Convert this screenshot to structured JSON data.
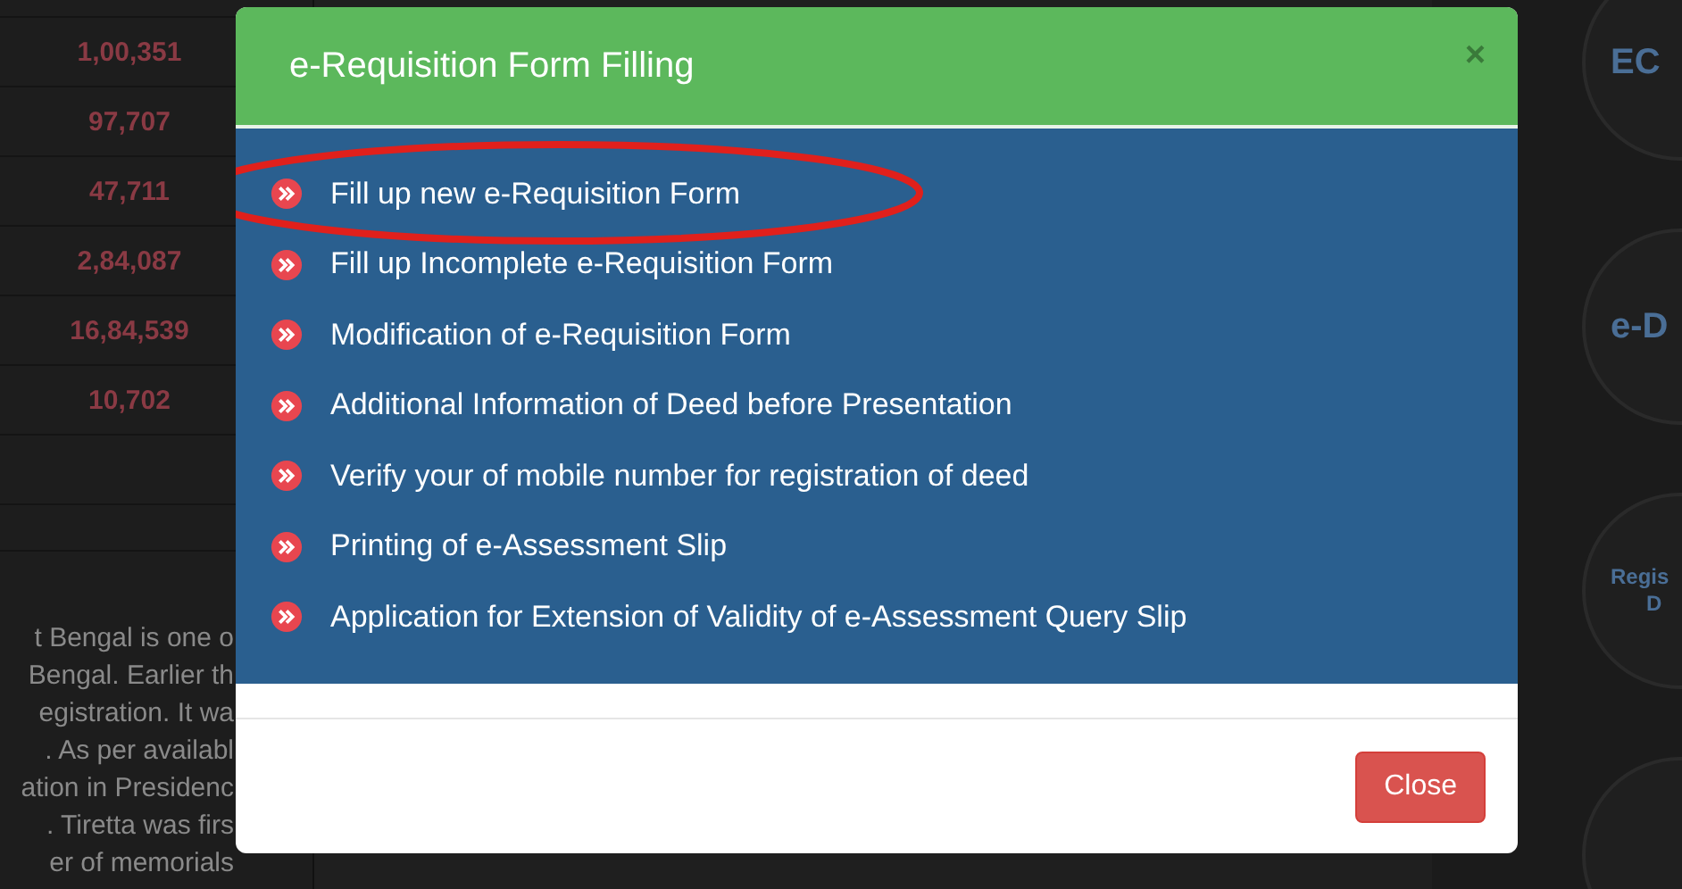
{
  "background_page": {
    "table_values": [
      "1,00,351",
      "97,707",
      "47,711",
      "2,84,087",
      "16,84,539",
      "10,702"
    ],
    "paragraph_lines": [
      "t Bengal is one o",
      "Bengal. Earlier th",
      "egistration. It wa",
      ". As per availabl",
      "ation in Presidenc",
      ". Tiretta was firs",
      "er of memorials"
    ],
    "side_tiles": [
      {
        "label": "EC"
      },
      {
        "label": "e-D"
      },
      {
        "label": "Regis",
        "sublabel": "D"
      }
    ]
  },
  "modal": {
    "title": "e-Requisition Form Filling",
    "close_icon": "×",
    "items": [
      {
        "label": "Fill up new e-Requisition Form",
        "highlighted": true
      },
      {
        "label": "Fill up Incomplete e-Requisition Form",
        "highlighted": false
      },
      {
        "label": "Modification of e-Requisition Form",
        "highlighted": false
      },
      {
        "label": "Additional Information of Deed before Presentation",
        "highlighted": false
      },
      {
        "label": "Verify your of mobile number for registration of deed",
        "highlighted": false
      },
      {
        "label": "Printing of e-Assessment Slip",
        "highlighted": false
      },
      {
        "label": "Application for Extension of Validity of e-Assessment Query Slip",
        "highlighted": false
      }
    ],
    "buttons": [
      "Close"
    ]
  }
}
